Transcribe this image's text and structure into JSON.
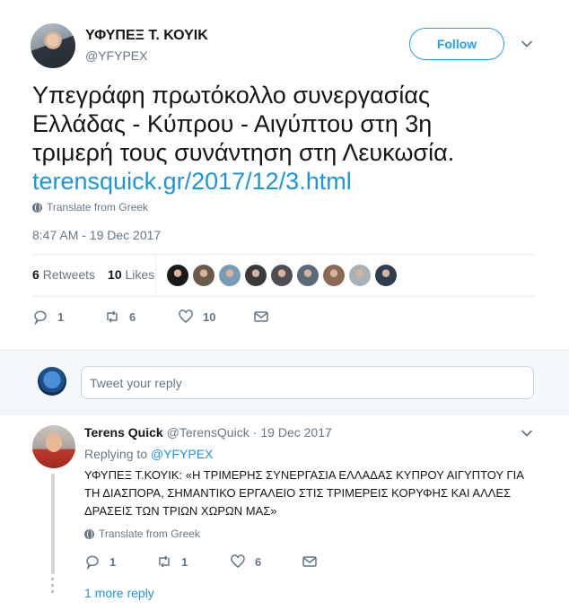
{
  "tweet": {
    "author_name": "ΥΦΥΠΕΞ Τ. ΚΟΥΙΚ",
    "author_handle": "@YFYPEX",
    "follow_label": "Follow",
    "text_line1": "Υπεγράφη πρωτόκολλο συνεργασίας",
    "text_line2": "Ελλάδας - Κύπρου - Αιγύπτου στη 3η",
    "text_line3": "τριμερή τους συνάντηση στη Λευκωσία.",
    "link": "terensquick.gr/2017/12/3.html",
    "translate_label": "Translate from Greek",
    "timestamp": "8:47 AM - 19 Dec 2017",
    "retweets_count": "6",
    "retweets_label": "Retweets",
    "likes_count": "10",
    "likes_label": "Likes",
    "likers": [
      "#1a1a1a",
      "#6b5a4a",
      "#7a9bb5",
      "#3a3a3a",
      "#4e4e55",
      "#5a6a7a",
      "#8a6a55",
      "#a8b0b8",
      "#2c3e50"
    ],
    "actions": {
      "reply_count": "1",
      "retweet_count": "6",
      "like_count": "10"
    }
  },
  "reply_box": {
    "placeholder": "Tweet your reply"
  },
  "reply": {
    "author_name": "Terens Quick",
    "author_handle": "@TerensQuick",
    "separator": "·",
    "date": "19 Dec 2017",
    "replying_to_label": "Replying to",
    "replying_to_handle": "@YFYPEX",
    "text": "ΥΦΥΠΕΞ Τ.ΚΟΥΙΚ: «Η ΤΡΙΜΕΡΗΣ ΣΥΝΕΡΓΑΣΙΑ ΕΛΛΑΔΑΣ ΚΥΠΡΟΥ ΑΙΓΥΠΤΟΥ ΓΙΑ ΤΗ ΔΙΑΣΠΟΡΑ, ΣΗΜΑΝΤΙΚΟ ΕΡΓΑΛΕΙΟ ΣΤΙΣ ΤΡΙΜΕΡΕΙΣ ΚΟΡΥΦΗΣ ΚΑΙ ΑΛΛΕΣ ΔΡΑΣΕΙΣ ΤΩΝ ΤΡΙΩΝ ΧΩΡΩΝ ΜΑΣ»",
    "translate_label": "Translate from Greek",
    "actions": {
      "reply_count": "1",
      "retweet_count": "1",
      "like_count": "6"
    },
    "more_replies_label": "1 more reply"
  },
  "colors": {
    "accent": "#1da1f2",
    "link": "#1b95e0",
    "muted": "#657786",
    "text": "#14171a"
  }
}
